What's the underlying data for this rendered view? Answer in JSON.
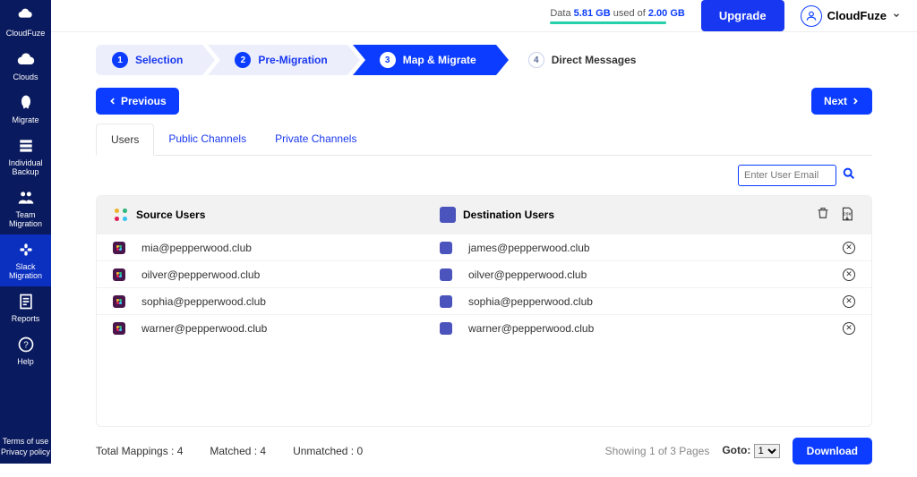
{
  "sidebar": {
    "logo": "CloudFuze",
    "items": [
      {
        "label": "Clouds"
      },
      {
        "label": "Migrate"
      },
      {
        "label": "Individual Backup"
      },
      {
        "label": "Team Migration"
      },
      {
        "label": "Slack Migration"
      },
      {
        "label": "Reports"
      },
      {
        "label": "Help"
      }
    ],
    "footer": {
      "terms": "Terms of use",
      "privacy": "Privacy policy"
    }
  },
  "topbar": {
    "data_label": "Data",
    "data_used": "5.81 GB",
    "data_mid": "used of",
    "data_total": "2.00 GB",
    "upgrade": "Upgrade",
    "profile": "CloudFuze"
  },
  "steps": [
    {
      "num": "1",
      "label": "Selection"
    },
    {
      "num": "2",
      "label": "Pre-Migration"
    },
    {
      "num": "3",
      "label": "Map & Migrate"
    },
    {
      "num": "4",
      "label": "Direct Messages"
    }
  ],
  "buttons": {
    "prev": "Previous",
    "next": "Next",
    "download": "Download"
  },
  "tabs": [
    {
      "label": "Users"
    },
    {
      "label": "Public Channels"
    },
    {
      "label": "Private Channels"
    }
  ],
  "search": {
    "placeholder": "Enter User Email"
  },
  "table": {
    "src_header": "Source Users",
    "dst_header": "Destination Users",
    "rows": [
      {
        "src": "mia@pepperwood.club",
        "dst": "james@pepperwood.club"
      },
      {
        "src": "oilver@pepperwood.club",
        "dst": "oilver@pepperwood.club"
      },
      {
        "src": "sophia@pepperwood.club",
        "dst": "sophia@pepperwood.club"
      },
      {
        "src": "warner@pepperwood.club",
        "dst": "warner@pepperwood.club"
      }
    ]
  },
  "footer": {
    "total": "Total Mappings : 4",
    "matched": "Matched : 4",
    "unmatched": "Unmatched : 0",
    "showing": "Showing 1 of 3 Pages",
    "goto_label": "Goto:",
    "goto_value": "1"
  }
}
